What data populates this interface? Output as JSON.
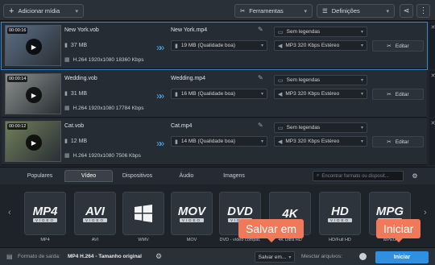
{
  "toolbar": {
    "add_media": "Adicionar mídia",
    "tools": "Ferramentas",
    "settings": "Definições"
  },
  "files": [
    {
      "timecode": "00:00:16",
      "name": "New York.vob",
      "size": "37 MB",
      "spec": "H.264 1920x1080 18360 Kbps",
      "out_name": "New York.mp4",
      "out_size": "19 MB (Qualidade boa)",
      "subtitles": "Sem legendas",
      "audio": "MP3 320 Kbps Estéreo",
      "edit": "Editar",
      "thumb_color": "#5c6f86"
    },
    {
      "timecode": "00:00:14",
      "name": "Wedding.vob",
      "size": "31 MB",
      "spec": "H.264 1920x1080 17784 Kbps",
      "out_name": "Wedding.mp4",
      "out_size": "16 MB (Qualidade boa)",
      "subtitles": "Sem legendas",
      "audio": "MP3 320 Kbps Estéreo",
      "edit": "Editar",
      "thumb_color": "#8a8f8c"
    },
    {
      "timecode": "00:00:12",
      "name": "Cat.vob",
      "size": "12 MB",
      "spec": "H.264 1920x1080 7506 Kbps",
      "out_name": "Cat.mp4",
      "out_size": "14 MB (Qualidade boa)",
      "subtitles": "Sem legendas",
      "audio": "MP3 320 Kbps Estéreo",
      "edit": "Editar",
      "thumb_color": "#6f7f5a"
    }
  ],
  "tabs": [
    "Populares",
    "Vídeo",
    "Dispositivos",
    "Áudio",
    "Imagens"
  ],
  "active_tab": "Vídeo",
  "search_placeholder": "Encontrar formato ou disposit...",
  "formats": [
    {
      "big": "MP4",
      "small": "VIDEO",
      "label": "MP4"
    },
    {
      "big": "AVI",
      "small": "VIDEO",
      "label": "AVI"
    },
    {
      "big": "",
      "small": "",
      "label": "WMV"
    },
    {
      "big": "MOV",
      "small": "VIDEO",
      "label": "MOV"
    },
    {
      "big": "DVD",
      "small": "VIDEO",
      "label": "DVD - vídeo compat."
    },
    {
      "big": "4K",
      "small": "",
      "label": "4K Ultra HD"
    },
    {
      "big": "HD",
      "small": "VIDEO",
      "label": "HD/Full HD"
    },
    {
      "big": "MPG",
      "small": "VIDEO",
      "label": "MPEG"
    }
  ],
  "status": {
    "output_label": "Formato de saída:",
    "output_value": "MP4 H.264 - Tamanho original",
    "save_to": "Salvar em...",
    "merge": "Mesclar arquivos:",
    "start": "Iniciar"
  },
  "callouts": {
    "save": "Salvar em",
    "start": "Iniciar"
  },
  "colors": {
    "accent": "#2f8fe0",
    "callout": "#f0795a"
  }
}
